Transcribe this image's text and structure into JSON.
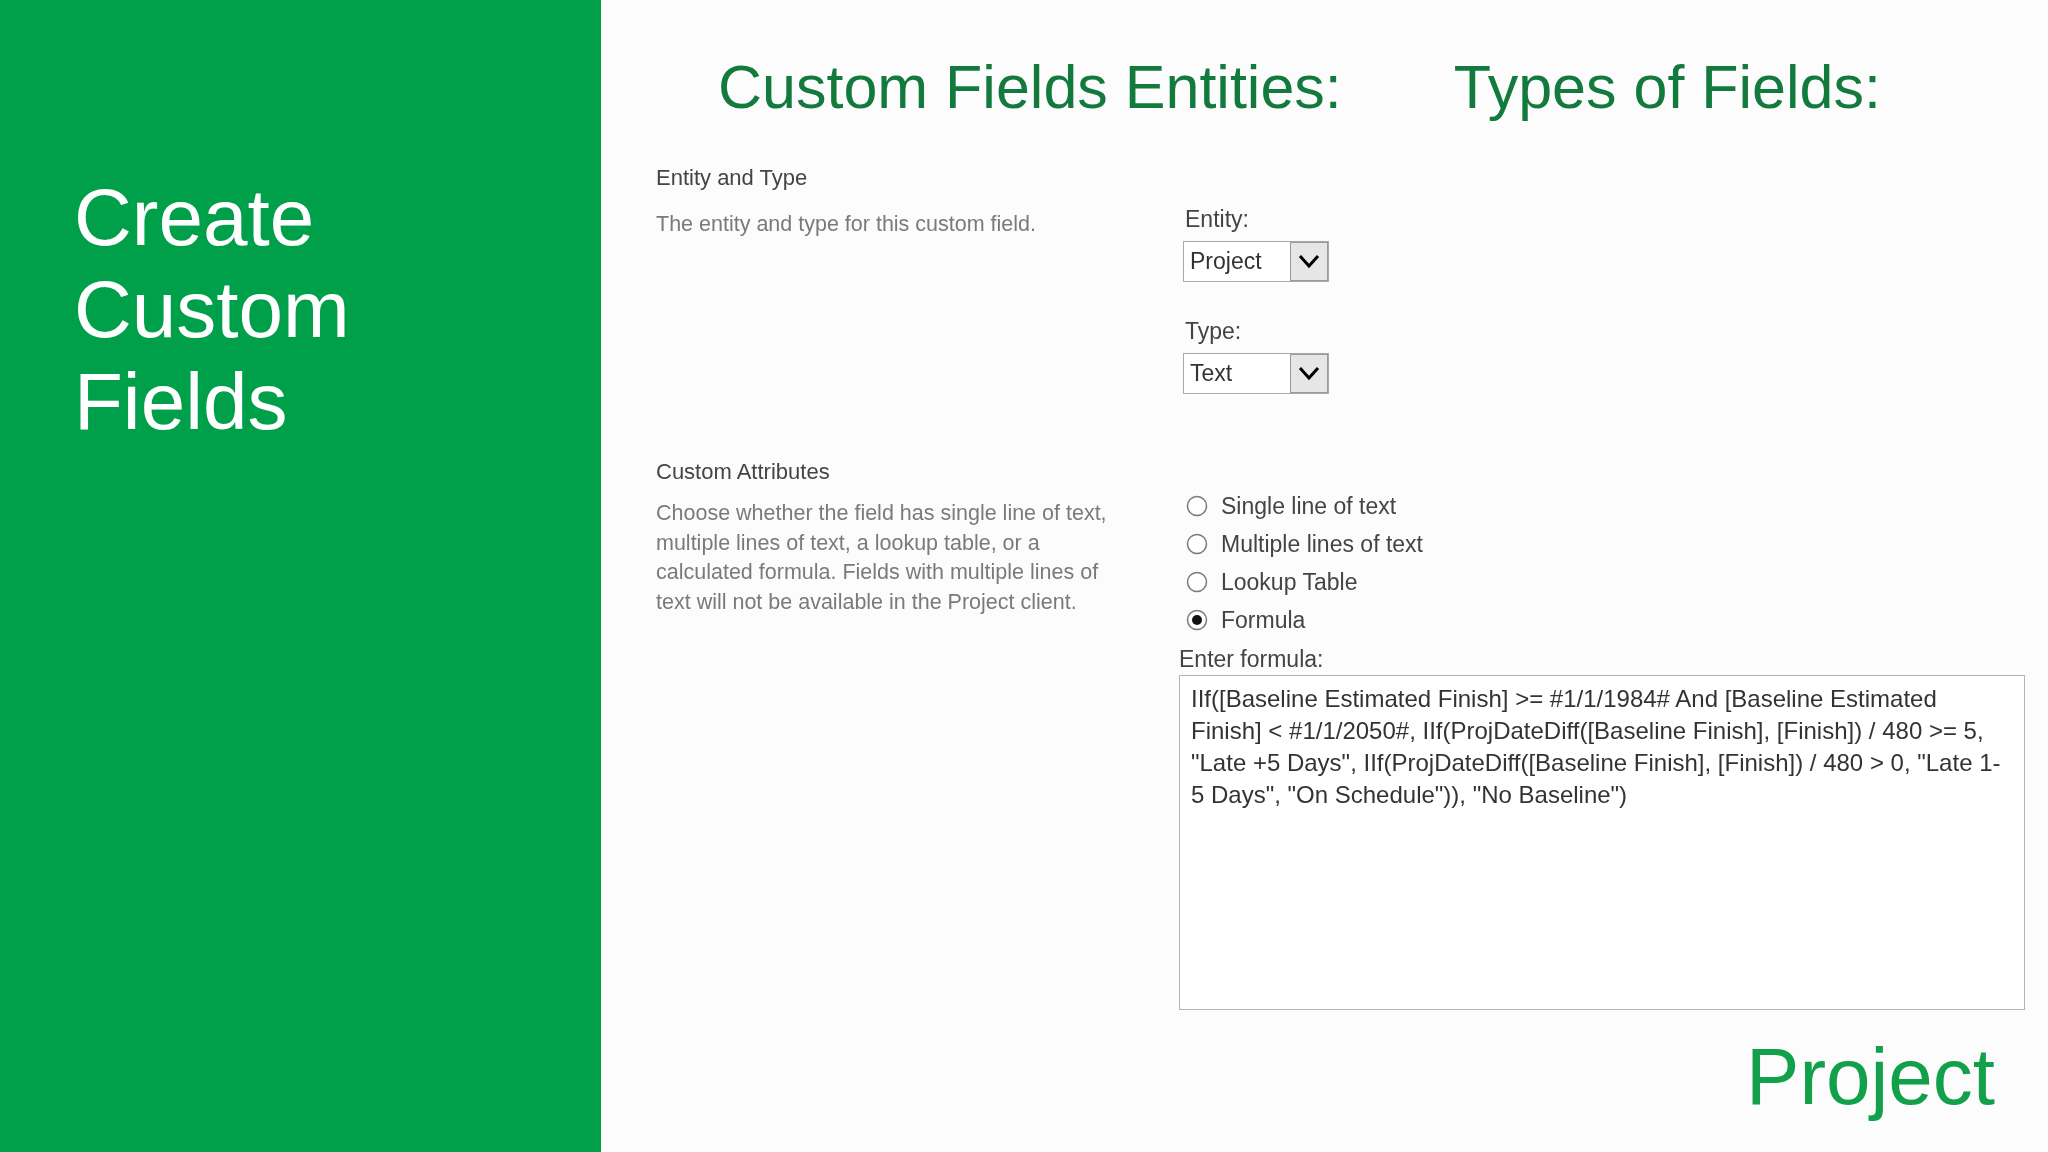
{
  "sidebar": {
    "title": "Create Custom Fields"
  },
  "headings": [
    "Custom Fields Entities:",
    "Types of Fields:"
  ],
  "sections": [
    {
      "kind": "dropdowns",
      "title": "Entity and Type",
      "description": "The entity and type for this custom field.",
      "dropdowns": [
        {
          "label": "Entity:",
          "value": "Project"
        },
        {
          "label": "Type:",
          "value": "Text"
        }
      ]
    },
    {
      "kind": "options",
      "title": "Custom Attributes",
      "description": "Choose whether the field has single line of text, multiple lines of text, a lookup table, or a calculated formula. Fields with multiple lines of text will not be available in the Project client.",
      "options": [
        {
          "label": "Single line of text",
          "selected": false
        },
        {
          "label": "Multiple lines of text",
          "selected": false
        },
        {
          "label": "Lookup Table",
          "selected": false
        },
        {
          "label": "Formula",
          "selected": true
        }
      ],
      "formula": {
        "label": "Enter formula:",
        "value": "IIf([Baseline Estimated Finish] >= #1/1/1984# And [Baseline Estimated Finish] < #1/1/2050#, IIf(ProjDateDiff([Baseline Finish], [Finish]) / 480 >= 5, \"Late +5 Days\", IIf(ProjDateDiff([Baseline Finish], [Finish]) / 480 > 0, \"Late 1-5 Days\", \"On Schedule\")), \"No Baseline\")"
      }
    }
  ],
  "brand": "Project"
}
